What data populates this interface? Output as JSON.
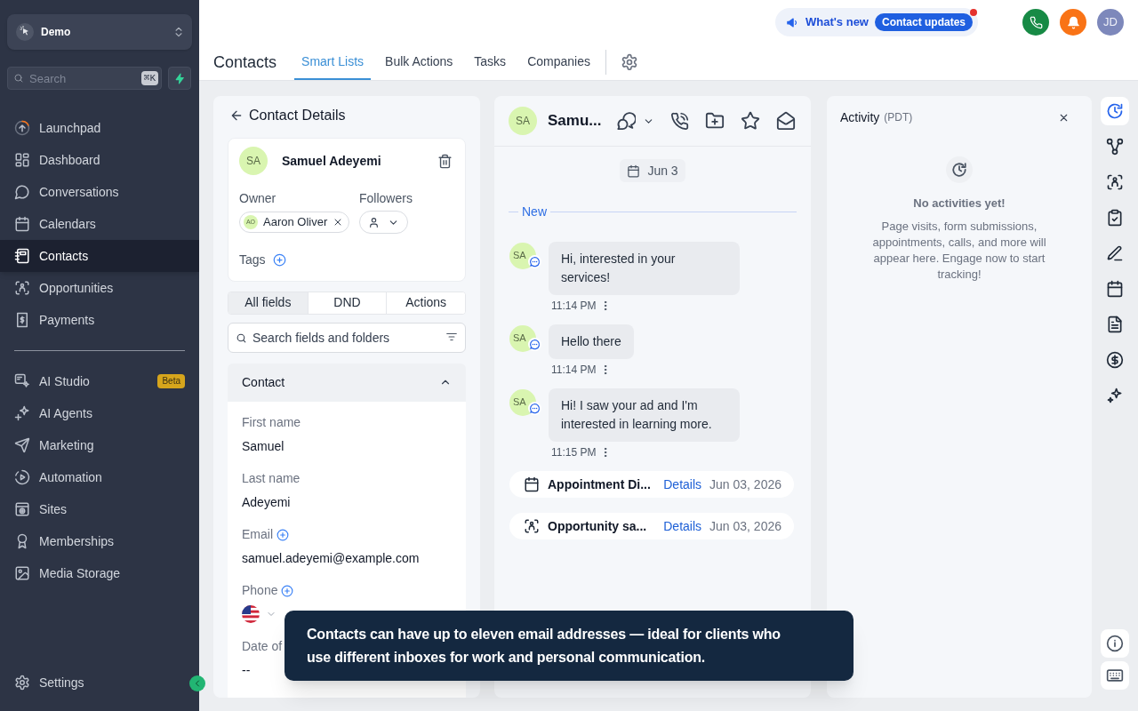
{
  "sidebar": {
    "workspace": {
      "name": "Demo"
    },
    "search": {
      "placeholder": "Search",
      "shortcut": "⌘K"
    },
    "nav_sections": [
      {
        "items": [
          {
            "label": "Launchpad",
            "selected": false
          },
          {
            "label": "Dashboard",
            "selected": false
          },
          {
            "label": "Conversations",
            "selected": false
          },
          {
            "label": "Calendars",
            "selected": false
          },
          {
            "label": "Contacts",
            "selected": true
          },
          {
            "label": "Opportunities",
            "selected": false
          },
          {
            "label": "Payments",
            "selected": false
          }
        ]
      },
      {
        "items": [
          {
            "label": "AI Studio",
            "selected": false,
            "badge": "Beta"
          },
          {
            "label": "AI Agents",
            "selected": false
          },
          {
            "label": "Marketing",
            "selected": false
          },
          {
            "label": "Automation",
            "selected": false
          },
          {
            "label": "Sites",
            "selected": false
          },
          {
            "label": "Memberships",
            "selected": false
          },
          {
            "label": "Media Storage",
            "selected": false
          }
        ]
      }
    ],
    "settings": {
      "label": "Settings"
    }
  },
  "topbar": {
    "title": "Contacts",
    "tabs": [
      {
        "label": "Smart Lists",
        "selected": true
      },
      {
        "label": "Bulk Actions",
        "selected": false
      },
      {
        "label": "Tasks",
        "selected": false
      },
      {
        "label": "Companies",
        "selected": false
      }
    ],
    "whats_new": {
      "label": "What's new",
      "badge": "Contact updates",
      "unread": true
    },
    "user": {
      "initials": "JD"
    }
  },
  "contact_panel": {
    "title": "Contact Details",
    "contact": {
      "initials": "SA",
      "name": "Samuel Adeyemi"
    },
    "owner": {
      "label": "Owner",
      "initials": "AO",
      "name": "Aaron Oliver"
    },
    "followers": {
      "label": "Followers"
    },
    "tags": {
      "label": "Tags"
    },
    "field_tabs": [
      {
        "label": "All fields",
        "selected": true
      },
      {
        "label": "DND",
        "selected": false
      },
      {
        "label": "Actions",
        "selected": false
      }
    ],
    "field_search": {
      "placeholder": "Search fields and folders"
    },
    "section": {
      "title": "Contact",
      "expanded": true,
      "fields": [
        {
          "kind": "text",
          "label": "First name",
          "addable": false,
          "value": "Samuel"
        },
        {
          "kind": "text",
          "label": "Last name",
          "addable": false,
          "value": "Adeyemi"
        },
        {
          "kind": "text",
          "label": "Email",
          "addable": true,
          "value": "samuel.adeyemi@example.com"
        },
        {
          "kind": "phone",
          "label": "Phone",
          "addable": true
        },
        {
          "kind": "text",
          "label": "Date of",
          "addable": false,
          "value": "--"
        }
      ]
    }
  },
  "conversation": {
    "contact": {
      "initials": "SA",
      "name": "Samu..."
    },
    "date": "Jun 3",
    "divider": "New",
    "messages": [
      {
        "initials": "SA",
        "text": "Hi, interested in your services!",
        "time": "11:14 PM"
      },
      {
        "initials": "SA",
        "text": "Hello there",
        "time": "11:14 PM"
      },
      {
        "initials": "SA",
        "text": "Hi! I saw your ad and I'm interested in learning more.",
        "time": "11:15 PM"
      }
    ],
    "events": [
      {
        "kind": "appointment",
        "title": "Appointment Di...",
        "link": "Details",
        "date": "Jun 03, 2026"
      },
      {
        "kind": "opportunity",
        "title": "Opportunity sa...",
        "link": "Details",
        "date": "Jun 03, 2026"
      }
    ]
  },
  "activity": {
    "title": "Activity",
    "timezone": "(PDT)",
    "empty_title": "No activities yet!",
    "empty_text": "Page visits, form submissions, appointments, calls, and more will appear here. Engage now to start tracking!"
  },
  "right_rail": {
    "items": [
      {
        "selected": true
      },
      {
        "selected": false
      },
      {
        "selected": false
      },
      {
        "selected": false
      },
      {
        "selected": false
      },
      {
        "selected": false
      },
      {
        "selected": false
      },
      {
        "selected": false
      },
      {
        "selected": false
      }
    ]
  },
  "tooltip": {
    "text": "Contacts can have up to eleven email addresses — ideal for clients who use different inboxes for work and personal communication."
  }
}
